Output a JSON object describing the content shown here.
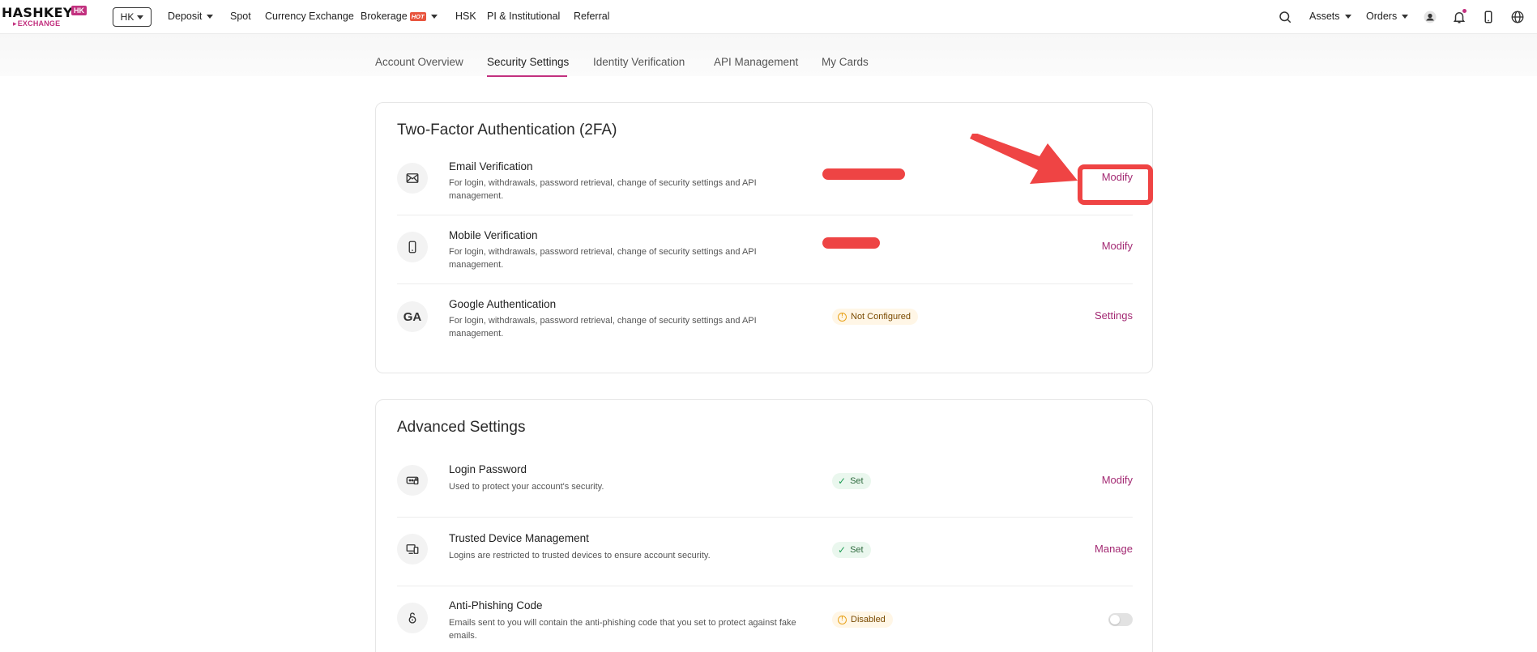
{
  "brand": {
    "logo_main": "HASHKEY",
    "logo_hk": "HK",
    "logo_sub": "EXCHANGE",
    "accent_color": "#c2317f"
  },
  "topnav": {
    "region": "HK",
    "items": [
      {
        "label": "Deposit",
        "dropdown": true
      },
      {
        "label": "Spot"
      },
      {
        "label": "Currency Exchange"
      },
      {
        "label": "Brokerage",
        "badge": "HOT",
        "dropdown": true
      },
      {
        "label": "HSK"
      },
      {
        "label": "PI & Institutional"
      },
      {
        "label": "Referral"
      }
    ],
    "assets_label": "Assets",
    "orders_label": "Orders",
    "icons": [
      "search-icon",
      "avatar-icon",
      "bell-icon",
      "mobile-icon",
      "globe-icon"
    ]
  },
  "tabs": [
    {
      "label": "Account Overview",
      "active": false
    },
    {
      "label": "Security Settings",
      "active": true
    },
    {
      "label": "Identity Verification",
      "active": false
    },
    {
      "label": "API Management",
      "active": false
    },
    {
      "label": "My Cards",
      "active": false
    }
  ],
  "twofa": {
    "title": "Two-Factor Authentication (2FA)",
    "rows": [
      {
        "icon": "envelope-icon",
        "title": "Email Verification",
        "desc": "For login, withdrawals, password retrieval, change of security settings and API management.",
        "status": "redacted",
        "action": "Modify"
      },
      {
        "icon": "mobile-icon",
        "title": "Mobile Verification",
        "desc": "For login, withdrawals, password retrieval, change of security settings and API management.",
        "status": "redacted",
        "action": "Modify"
      },
      {
        "icon_text": "GA",
        "title": "Google Authentication",
        "desc": "For login, withdrawals, password retrieval, change of security settings and API management.",
        "status": "Not Configured",
        "action": "Settings"
      }
    ]
  },
  "advanced": {
    "title": "Advanced Settings",
    "rows": [
      {
        "icon": "password-icon",
        "title": "Login Password",
        "desc": "Used to protect your account's security.",
        "status": "Set",
        "action": "Modify"
      },
      {
        "icon": "devices-icon",
        "title": "Trusted Device Management",
        "desc": "Logins are restricted to trusted devices to ensure account security.",
        "status": "Set",
        "action": "Manage"
      },
      {
        "icon": "lock-open-icon",
        "title": "Anti-Phishing Code",
        "desc": "Emails sent to you will contain the anti-phishing code that you set to protect against fake emails.",
        "status": "Disabled",
        "toggle": false
      }
    ]
  },
  "annotation": {
    "color": "#ef4444"
  }
}
